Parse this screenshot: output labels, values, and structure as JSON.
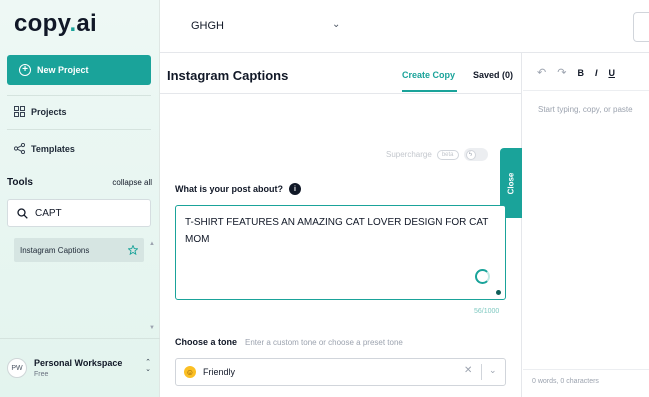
{
  "sidebar": {
    "logo_main": "copy",
    "logo_dot": ".",
    "logo_suffix": "ai",
    "new_project_label": "New Project",
    "nav_items": [
      {
        "label": "Projects",
        "icon": "grid-icon"
      },
      {
        "label": "Templates",
        "icon": "share-nodes-icon"
      }
    ],
    "tools_label": "Tools",
    "collapse_all_label": "collapse all",
    "tool_search_value": "CAPT",
    "tool_item_label": "Instagram Captions",
    "workspace": {
      "avatar_initials": "PW",
      "name": "Personal Workspace",
      "plan": "Free"
    }
  },
  "topbar": {
    "project_name": "GHGH"
  },
  "main": {
    "title": "Instagram Captions",
    "tabs": [
      {
        "label": "Create Copy",
        "active": true
      },
      {
        "label": "Saved (0)",
        "active": false
      }
    ],
    "supercharge_label": "Supercharge",
    "beta_label": "beta",
    "close_label": "Close",
    "post_about_label": "What is your post about?",
    "info_glyph": "i",
    "post_about_value": "T-SHIRT FEATURES AN AMAZING CAT LOVER DESIGN FOR CAT MOM",
    "char_count": "56/1000",
    "tone_label": "Choose a tone",
    "tone_hint": "Enter a custom tone or choose a preset tone",
    "tone_value": "Friendly"
  },
  "editor": {
    "placeholder": "Start typing, copy, or paste",
    "word_count": "0 words, 0 characters"
  },
  "colors": {
    "accent": "#1aa39a",
    "sidebar_bg": "#e3f4ee"
  }
}
